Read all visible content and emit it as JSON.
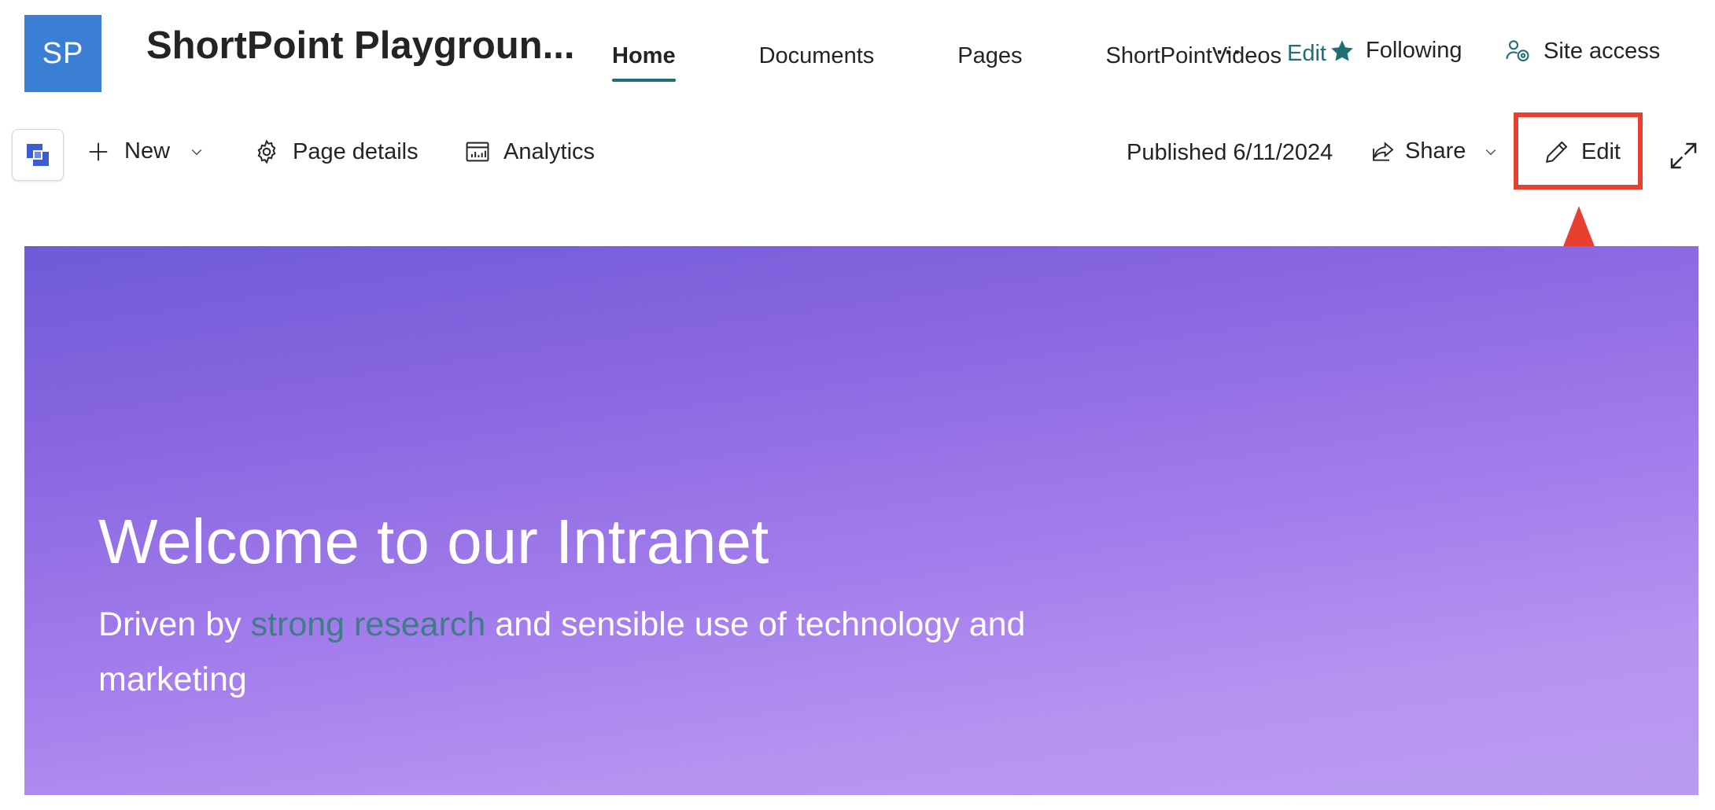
{
  "site": {
    "logo_text": "SP",
    "title": "ShortPoint Playgroun...",
    "logo_color": "#3b7fd4"
  },
  "nav": {
    "items": [
      {
        "label": "Home",
        "active": true
      },
      {
        "label": "Documents",
        "active": false
      },
      {
        "label": "Pages",
        "active": false
      },
      {
        "label": "ShortPointVideos",
        "active": false
      }
    ],
    "more_label": "···",
    "edit_label": "Edit",
    "following_label": "Following",
    "site_access_label": "Site access",
    "accent_color": "#1f6f74"
  },
  "command_bar": {
    "new_label": "New",
    "page_details_label": "Page details",
    "analytics_label": "Analytics",
    "published_label": "Published 6/11/2024",
    "share_label": "Share",
    "edit_label": "Edit"
  },
  "hero": {
    "title": "Welcome to our Intranet",
    "subtitle_prefix": "Driven by ",
    "subtitle_accent": "strong research",
    "subtitle_suffix": " and sensible use of technology and marketing"
  },
  "annotation": {
    "color": "#e8402f"
  },
  "icons": {
    "app_icon": "shortpoint-logo-icon",
    "new": "plus-icon",
    "page_details": "gear-icon",
    "analytics": "analytics-icon",
    "share": "share-icon",
    "edit": "pencil-icon",
    "expand": "expand-icon",
    "following": "star-icon",
    "site_access": "people-settings-icon"
  }
}
